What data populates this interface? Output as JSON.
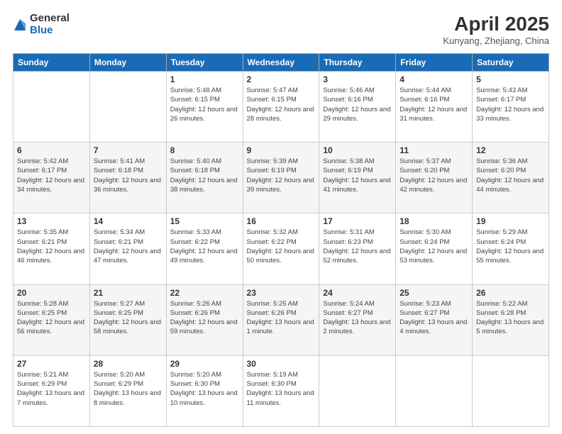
{
  "header": {
    "logo_general": "General",
    "logo_blue": "Blue",
    "title": "April 2025",
    "subtitle": "Kunyang, Zhejiang, China"
  },
  "columns": [
    "Sunday",
    "Monday",
    "Tuesday",
    "Wednesday",
    "Thursday",
    "Friday",
    "Saturday"
  ],
  "weeks": [
    [
      {
        "day": "",
        "info": ""
      },
      {
        "day": "",
        "info": ""
      },
      {
        "day": "1",
        "info": "Sunrise: 5:48 AM\nSunset: 6:15 PM\nDaylight: 12 hours and 26 minutes."
      },
      {
        "day": "2",
        "info": "Sunrise: 5:47 AM\nSunset: 6:15 PM\nDaylight: 12 hours and 28 minutes."
      },
      {
        "day": "3",
        "info": "Sunrise: 5:46 AM\nSunset: 6:16 PM\nDaylight: 12 hours and 29 minutes."
      },
      {
        "day": "4",
        "info": "Sunrise: 5:44 AM\nSunset: 6:16 PM\nDaylight: 12 hours and 31 minutes."
      },
      {
        "day": "5",
        "info": "Sunrise: 5:43 AM\nSunset: 6:17 PM\nDaylight: 12 hours and 33 minutes."
      }
    ],
    [
      {
        "day": "6",
        "info": "Sunrise: 5:42 AM\nSunset: 6:17 PM\nDaylight: 12 hours and 34 minutes."
      },
      {
        "day": "7",
        "info": "Sunrise: 5:41 AM\nSunset: 6:18 PM\nDaylight: 12 hours and 36 minutes."
      },
      {
        "day": "8",
        "info": "Sunrise: 5:40 AM\nSunset: 6:18 PM\nDaylight: 12 hours and 38 minutes."
      },
      {
        "day": "9",
        "info": "Sunrise: 5:39 AM\nSunset: 6:19 PM\nDaylight: 12 hours and 39 minutes."
      },
      {
        "day": "10",
        "info": "Sunrise: 5:38 AM\nSunset: 6:19 PM\nDaylight: 12 hours and 41 minutes."
      },
      {
        "day": "11",
        "info": "Sunrise: 5:37 AM\nSunset: 6:20 PM\nDaylight: 12 hours and 42 minutes."
      },
      {
        "day": "12",
        "info": "Sunrise: 5:36 AM\nSunset: 6:20 PM\nDaylight: 12 hours and 44 minutes."
      }
    ],
    [
      {
        "day": "13",
        "info": "Sunrise: 5:35 AM\nSunset: 6:21 PM\nDaylight: 12 hours and 46 minutes."
      },
      {
        "day": "14",
        "info": "Sunrise: 5:34 AM\nSunset: 6:21 PM\nDaylight: 12 hours and 47 minutes."
      },
      {
        "day": "15",
        "info": "Sunrise: 5:33 AM\nSunset: 6:22 PM\nDaylight: 12 hours and 49 minutes."
      },
      {
        "day": "16",
        "info": "Sunrise: 5:32 AM\nSunset: 6:22 PM\nDaylight: 12 hours and 50 minutes."
      },
      {
        "day": "17",
        "info": "Sunrise: 5:31 AM\nSunset: 6:23 PM\nDaylight: 12 hours and 52 minutes."
      },
      {
        "day": "18",
        "info": "Sunrise: 5:30 AM\nSunset: 6:24 PM\nDaylight: 12 hours and 53 minutes."
      },
      {
        "day": "19",
        "info": "Sunrise: 5:29 AM\nSunset: 6:24 PM\nDaylight: 12 hours and 55 minutes."
      }
    ],
    [
      {
        "day": "20",
        "info": "Sunrise: 5:28 AM\nSunset: 6:25 PM\nDaylight: 12 hours and 56 minutes."
      },
      {
        "day": "21",
        "info": "Sunrise: 5:27 AM\nSunset: 6:25 PM\nDaylight: 12 hours and 58 minutes."
      },
      {
        "day": "22",
        "info": "Sunrise: 5:26 AM\nSunset: 6:26 PM\nDaylight: 12 hours and 59 minutes."
      },
      {
        "day": "23",
        "info": "Sunrise: 5:25 AM\nSunset: 6:26 PM\nDaylight: 13 hours and 1 minute."
      },
      {
        "day": "24",
        "info": "Sunrise: 5:24 AM\nSunset: 6:27 PM\nDaylight: 13 hours and 2 minutes."
      },
      {
        "day": "25",
        "info": "Sunrise: 5:23 AM\nSunset: 6:27 PM\nDaylight: 13 hours and 4 minutes."
      },
      {
        "day": "26",
        "info": "Sunrise: 5:22 AM\nSunset: 6:28 PM\nDaylight: 13 hours and 5 minutes."
      }
    ],
    [
      {
        "day": "27",
        "info": "Sunrise: 5:21 AM\nSunset: 6:29 PM\nDaylight: 13 hours and 7 minutes."
      },
      {
        "day": "28",
        "info": "Sunrise: 5:20 AM\nSunset: 6:29 PM\nDaylight: 13 hours and 8 minutes."
      },
      {
        "day": "29",
        "info": "Sunrise: 5:20 AM\nSunset: 6:30 PM\nDaylight: 13 hours and 10 minutes."
      },
      {
        "day": "30",
        "info": "Sunrise: 5:19 AM\nSunset: 6:30 PM\nDaylight: 13 hours and 11 minutes."
      },
      {
        "day": "",
        "info": ""
      },
      {
        "day": "",
        "info": ""
      },
      {
        "day": "",
        "info": ""
      }
    ]
  ]
}
